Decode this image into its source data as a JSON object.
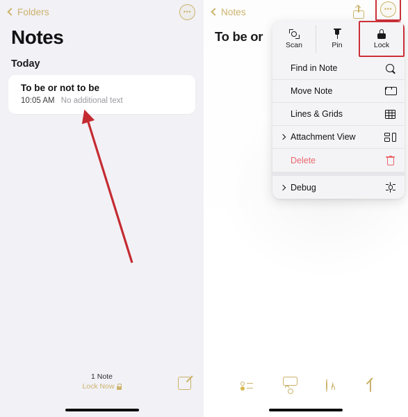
{
  "left_screen": {
    "nav": {
      "back_label": "Folders",
      "more_icon": "ellipsis-circle-icon"
    },
    "title": "Notes",
    "section_header": "Today",
    "note": {
      "title": "To be or not to be",
      "time": "10:05 AM",
      "preview": "No additional text"
    },
    "bottom": {
      "count": "1 Note",
      "lock_now": "Lock Now",
      "compose_icon": "compose-icon"
    }
  },
  "right_screen": {
    "nav": {
      "back_label": "Notes",
      "share_icon": "share-icon",
      "more_icon": "ellipsis-circle-icon"
    },
    "note_title": "To be or",
    "menu": {
      "actions": [
        {
          "label": "Scan",
          "icon": "scan-icon",
          "highlighted": false
        },
        {
          "label": "Pin",
          "icon": "pin-icon",
          "highlighted": false
        },
        {
          "label": "Lock",
          "icon": "lock-icon",
          "highlighted": true
        }
      ],
      "items": [
        {
          "label": "Find in Note",
          "icon": "search-icon",
          "has_chevron": false,
          "danger": false
        },
        {
          "label": "Move Note",
          "icon": "folder-icon",
          "has_chevron": false,
          "danger": false
        },
        {
          "label": "Lines & Grids",
          "icon": "grid-icon",
          "has_chevron": false,
          "danger": false
        },
        {
          "label": "Attachment View",
          "icon": "attachment-view-icon",
          "has_chevron": true,
          "danger": false
        },
        {
          "label": "Delete",
          "icon": "trash-icon",
          "has_chevron": false,
          "danger": true
        }
      ],
      "secondary_items": [
        {
          "label": "Debug",
          "icon": "bug-icon",
          "has_chevron": true,
          "danger": false
        }
      ]
    },
    "toolbar": [
      {
        "icon": "checklist-icon"
      },
      {
        "icon": "camera-icon"
      },
      {
        "icon": "markup-icon"
      },
      {
        "icon": "compose-icon"
      }
    ]
  },
  "annotation": {
    "arrow_color": "#c42b31",
    "highlight_color": "#cc2f38"
  },
  "colors": {
    "accent_gold": "#cbb26a",
    "panel_bg": "#f2f1f6",
    "menu_bg": "#f4f4f6",
    "danger": "#e8676e"
  }
}
